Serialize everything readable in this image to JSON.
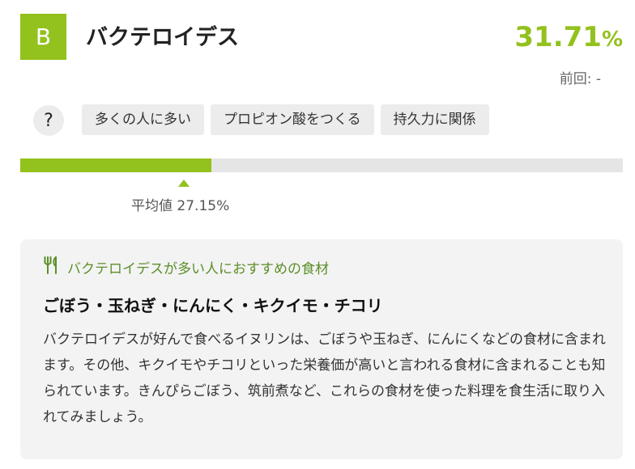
{
  "header": {
    "grade": "B",
    "name": "バクテロイデス",
    "percent_value": "31.71",
    "percent_unit": "%",
    "previous": "前回:  -"
  },
  "help": {
    "label": "?"
  },
  "tags": [
    {
      "label": "多くの人に多い"
    },
    {
      "label": "プロピオン酸をつくる"
    },
    {
      "label": "持久力に関係"
    }
  ],
  "progress": {
    "value_percent": 31.71,
    "fill_fraction": 0.317,
    "average_label": "平均値 27.15%",
    "average_fraction": 0.271
  },
  "colors": {
    "accent": "#93c11e",
    "heading_green": "#5c8f2a",
    "track": "#e5e5e5",
    "card_bg": "#f3f3f3"
  },
  "food_card": {
    "icon": "fork-knife-icon",
    "heading": "バクテロイデスが多い人におすすめの食材",
    "title": "ごぼう・玉ねぎ・にんにく・キクイモ・チコリ",
    "body": "バクテロイデスが好んで食べるイヌリンは、ごぼうや玉ねぎ、にんにくなどの食材に含まれます。その他、キクイモやチコリといった栄養価が高いと言われる食材に含まれることも知られています。きんぴらごぼう、筑前煮など、これらの食材を使った料理を食生活に取り入れてみましょう。"
  }
}
